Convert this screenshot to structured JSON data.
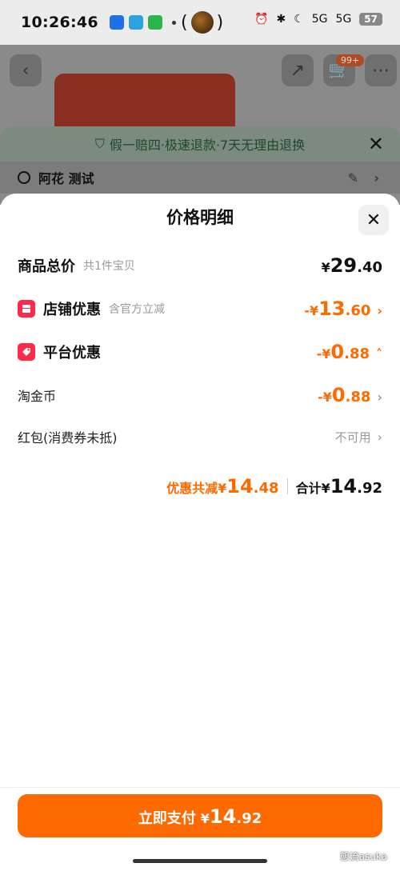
{
  "status_bar": {
    "time": "10:26:46",
    "center_left": "(",
    "center_right": ")",
    "signal_1": "5G",
    "signal_2": "5G",
    "battery": "57"
  },
  "background": {
    "cart_count": "99+",
    "guarantee_text": "假一赔四·极速退款·7天无理由退换",
    "address_text": "阿花 测试"
  },
  "sheet": {
    "title": "价格明细",
    "rows": [
      {
        "label": "商品总价",
        "sub": "共1件宝贝",
        "sym": "¥",
        "int": "29",
        "dec": ".40"
      },
      {
        "label": "店铺优惠",
        "sub": "含官方立减",
        "sym": "-¥",
        "int": "13",
        "dec": ".60"
      },
      {
        "label": "平台优惠",
        "sub": "",
        "sym": "-¥",
        "int": "0",
        "dec": ".88"
      },
      {
        "label": "淘金币",
        "sub": "",
        "sym": "-¥",
        "int": "0",
        "dec": ".88"
      },
      {
        "label": "红包(消费券未抵)",
        "sub": "",
        "value": "不可用"
      }
    ],
    "summary": {
      "saving_label": "优惠共减¥",
      "saving_int": "14",
      "saving_dec": ".48",
      "total_label": "合计¥",
      "total_int": "14",
      "total_dec": ".92"
    }
  },
  "pay_button": {
    "label": "立即支付",
    "sym": "¥",
    "int": "14",
    "dec": ".92"
  },
  "watermark": "憩流asuka",
  "colors": {
    "accent": "#ff6a00",
    "badge_red": "#ff2a4a"
  }
}
